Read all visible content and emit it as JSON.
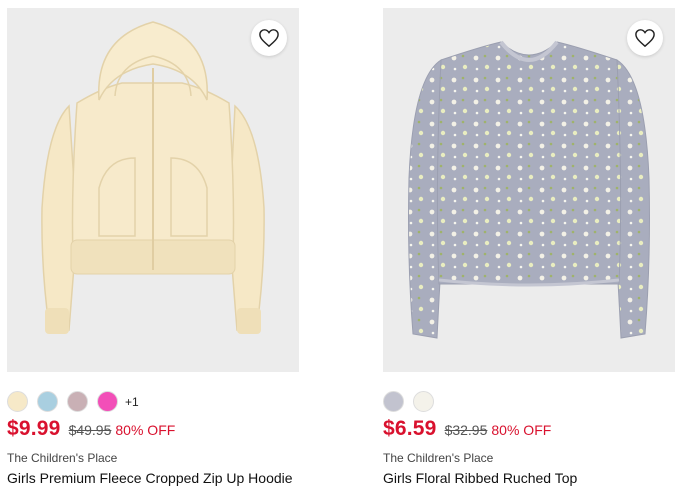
{
  "products": [
    {
      "name": "Girls Premium Fleece Cropped Zip Up Hoodie",
      "brand": "The Children's Place",
      "price": "$9.99",
      "was_price": "$49.95",
      "discount": "80% OFF",
      "swatch_colors": [
        "#f6e9c8",
        "#a9cfe0",
        "#c9b0b5",
        "#f24fb8"
      ],
      "more_swatches": "+1",
      "favorite_icon": "heart-outline-icon"
    },
    {
      "name": "Girls Floral Ribbed Ruched Top",
      "brand": "The Children's Place",
      "price": "$6.59",
      "was_price": "$32.95",
      "discount": "80% OFF",
      "swatch_colors": [
        "#c2c3cf",
        "#f4f2ea"
      ],
      "favorite_icon": "heart-outline-icon"
    }
  ],
  "colors": {
    "sale_red": "#d9112e",
    "image_bg": "#ececec"
  }
}
